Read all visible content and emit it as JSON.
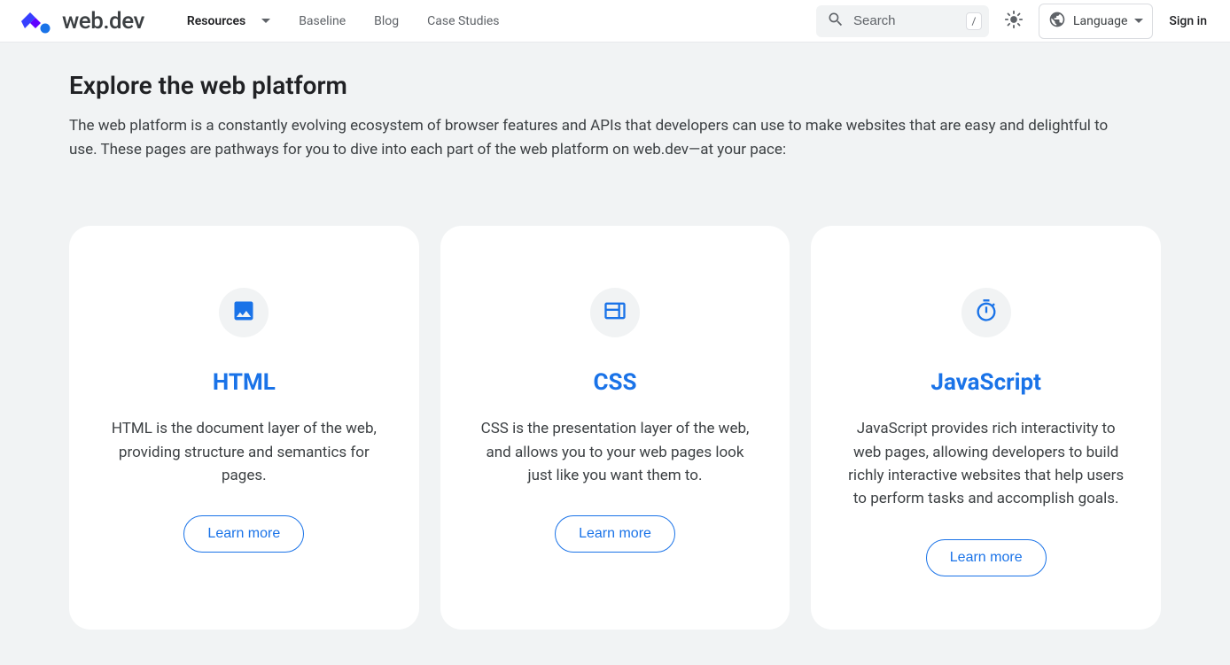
{
  "header": {
    "logo_text": "web.dev",
    "nav": [
      {
        "label": "Resources",
        "active": true,
        "dropdown": true
      },
      {
        "label": "Baseline"
      },
      {
        "label": "Blog"
      },
      {
        "label": "Case Studies"
      }
    ],
    "search_placeholder": "Search",
    "search_kbd": "/",
    "language_label": "Language",
    "signin_label": "Sign in"
  },
  "main": {
    "title": "Explore the web platform",
    "description": "The web platform is a constantly evolving ecosystem of browser features and APIs that developers can use to make websites that are easy and delightful to use. These pages are pathways for you to dive into each part of the web platform on web.dev—at your pace:"
  },
  "cards": [
    {
      "icon": "image-icon",
      "title": "HTML",
      "description": "HTML is the document layer of the web, providing structure and semantics for pages.",
      "button": "Learn more"
    },
    {
      "icon": "web-icon",
      "title": "CSS",
      "description": "CSS is the presentation layer of the web, and allows you to your web pages look just like you want them to.",
      "button": "Learn more"
    },
    {
      "icon": "timer-icon",
      "title": "JavaScript",
      "description": "JavaScript provides rich interactivity to web pages, allowing developers to build richly interactive websites that help users to perform tasks and accomplish goals.",
      "button": "Learn more"
    }
  ]
}
